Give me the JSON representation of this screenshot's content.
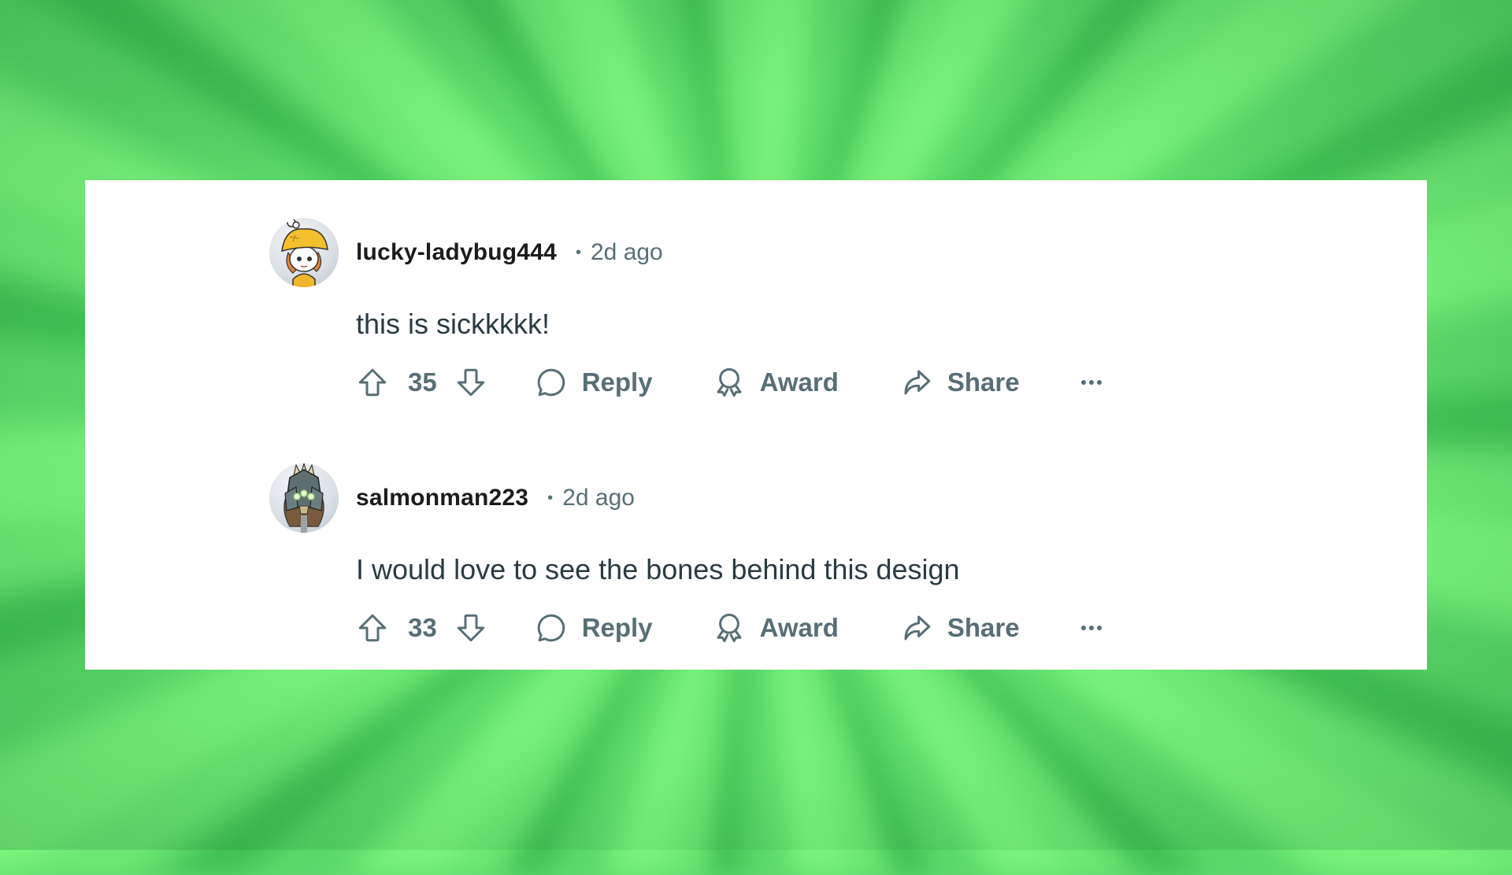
{
  "colors": {
    "background_accent": "#5fd96e",
    "card": "#ffffff",
    "username": "#1c1c1c",
    "meta": "#576f76",
    "body_text": "#2a3c42"
  },
  "comments": [
    {
      "username": "lucky-ladybug444",
      "separator": "•",
      "time": "2d ago",
      "body": "this is sickkkkk!",
      "score": "35",
      "avatar": "avatar-girl-yellow-bucket-hat",
      "actions": {
        "upvote_icon": "arrow-up-outline-icon",
        "downvote_icon": "arrow-down-outline-icon",
        "reply_label": "Reply",
        "reply_icon": "speech-bubble-icon",
        "award_label": "Award",
        "award_icon": "ribbon-award-icon",
        "share_label": "Share",
        "share_icon": "curved-arrow-share-icon",
        "more_icon": "ellipsis-icon"
      }
    },
    {
      "username": "salmonman223",
      "separator": "•",
      "time": "2d ago",
      "body": "I would love to see the bones behind this design",
      "score": "33",
      "avatar": "avatar-armored-knight",
      "actions": {
        "upvote_icon": "arrow-up-outline-icon",
        "downvote_icon": "arrow-down-outline-icon",
        "reply_label": "Reply",
        "reply_icon": "speech-bubble-icon",
        "award_label": "Award",
        "award_icon": "ribbon-award-icon",
        "share_label": "Share",
        "share_icon": "curved-arrow-share-icon",
        "more_icon": "ellipsis-icon"
      }
    }
  ]
}
